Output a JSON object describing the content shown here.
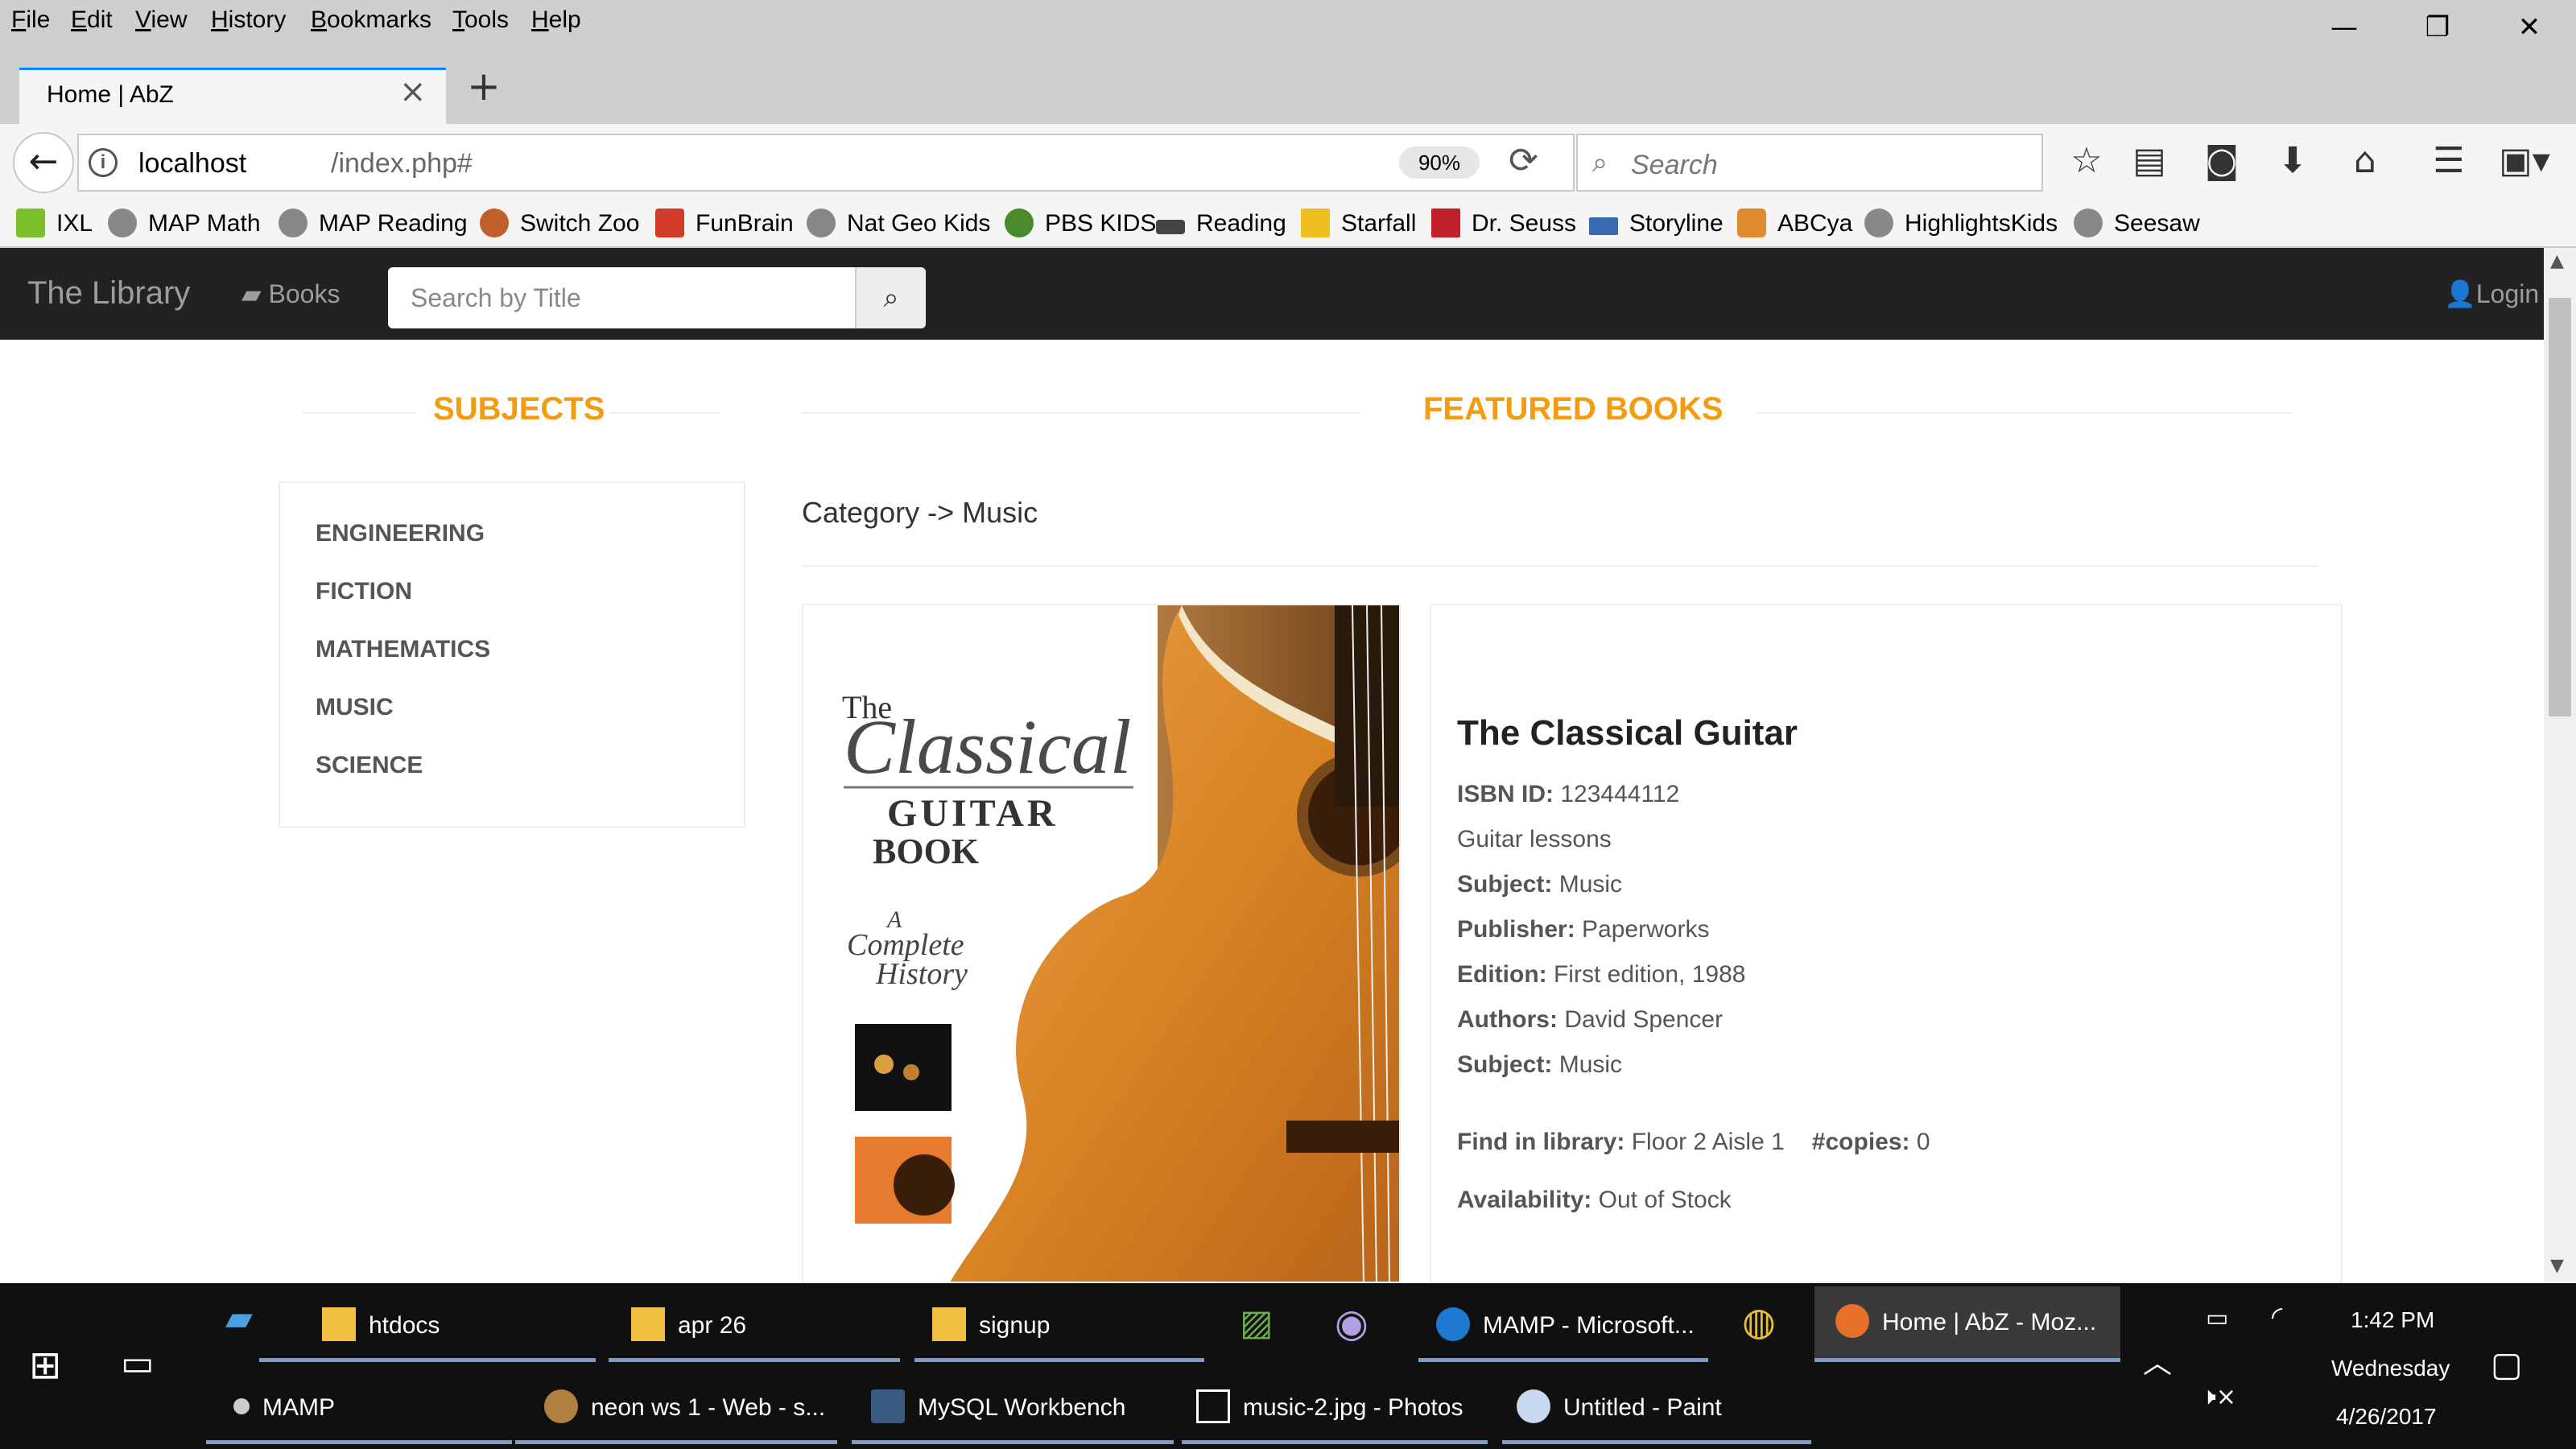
{
  "browser": {
    "menu": [
      "File",
      "Edit",
      "View",
      "History",
      "Bookmarks",
      "Tools",
      "Help"
    ],
    "window_controls": {
      "minimize": "—",
      "restore": "❐",
      "close": "✕"
    },
    "tab": {
      "title": "Home | AbZ",
      "close": "×",
      "new_tab": "+"
    },
    "url": {
      "host": "localhost",
      "path": "/index.php#"
    },
    "zoom": "90%",
    "search_placeholder": "Search",
    "toolbar_icons": [
      "star-icon",
      "reading-list-icon",
      "pocket-icon",
      "download-icon",
      "home-icon",
      "menu-icon",
      "extension-icon"
    ],
    "bookmarks": [
      {
        "label": "IXL",
        "color": "#7bbf2a"
      },
      {
        "label": "MAP Math",
        "color": "#777777"
      },
      {
        "label": "MAP Reading",
        "color": "#777777"
      },
      {
        "label": "Switch Zoo",
        "color": "#c0602a"
      },
      {
        "label": "FunBrain",
        "color": "#d23a2a"
      },
      {
        "label": "Nat Geo Kids",
        "color": "#777777"
      },
      {
        "label": "PBS KIDS",
        "color": "#4a8a2a"
      },
      {
        "label": "Reading",
        "color": "#444444"
      },
      {
        "label": "Starfall",
        "color": "#f0c020"
      },
      {
        "label": "Dr. Seuss",
        "color": "#c0202a"
      },
      {
        "label": "Storyline",
        "color": "#3a6ab0"
      },
      {
        "label": "ABCya",
        "color": "#e08a30"
      },
      {
        "label": "HighlightsKids",
        "color": "#777777"
      },
      {
        "label": "Seesaw",
        "color": "#777777"
      }
    ]
  },
  "site": {
    "brand": "The Library",
    "nav_books": "Books",
    "search_placeholder": "Search by Title",
    "login": "Login",
    "accent": "#f39c12"
  },
  "subjects": {
    "heading": "SUBJECTS",
    "items": [
      "ENGINEERING",
      "FICTION",
      "MATHEMATICS",
      "MUSIC",
      "SCIENCE"
    ]
  },
  "featured": {
    "heading": "FEATURED BOOKS",
    "category": "Category -> Music",
    "book": {
      "title": "The Classical Guitar",
      "isbn_label": "ISBN ID:",
      "isbn": "123444112",
      "description": "Guitar lessons",
      "subject_label": "Subject:",
      "subject": "Music",
      "publisher_label": "Publisher:",
      "publisher": "Paperworks",
      "edition_label": "Edition:",
      "edition": "First edition, 1988",
      "authors_label": "Authors:",
      "authors": "David Spencer",
      "subject2_label": "Subject:",
      "subject2": "Music",
      "location_label": "Find in library:",
      "location": "Floor 2 Aisle 1",
      "copies_label": "#copies:",
      "copies": "0",
      "availability_label": "Availability:",
      "availability": "Out of Stock"
    },
    "cover": {
      "the": "The",
      "classical": "Classical",
      "guitar": "GUITAR",
      "book": "BOOK",
      "subtitle_1": "A",
      "subtitle_2": "Complete",
      "subtitle_3": "History"
    }
  },
  "taskbar": {
    "row1": [
      {
        "label": "htdocs"
      },
      {
        "label": "apr 26"
      },
      {
        "label": "signup"
      },
      {
        "label": "MAMP - Microsoft..."
      },
      {
        "label": "Home | AbZ - Moz..."
      }
    ],
    "row2": [
      {
        "label": "MAMP"
      },
      {
        "label": "neon ws 1 - Web - s..."
      },
      {
        "label": "MySQL Workbench"
      },
      {
        "label": "music-2.jpg - Photos"
      },
      {
        "label": "Untitled - Paint"
      }
    ],
    "clock": {
      "time": "1:42 PM",
      "day": "Wednesday",
      "date": "4/26/2017"
    }
  }
}
